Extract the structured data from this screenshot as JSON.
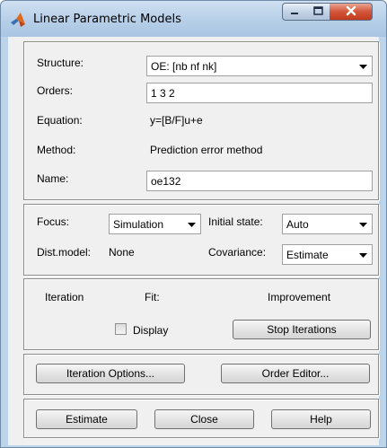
{
  "window": {
    "title": "Linear Parametric Models",
    "icon": "matlab-logo-icon",
    "controls": [
      "minimize-icon",
      "maximize-icon",
      "close-icon"
    ]
  },
  "model": {
    "structure_label": "Structure:",
    "structure_value": "OE: [nb nf nk]",
    "orders_label": "Orders:",
    "orders_value": "1 3 2",
    "equation_label": "Equation:",
    "equation_value": "y=[B/F]u+e",
    "method_label": "Method:",
    "method_value": "Prediction error method",
    "name_label": "Name:",
    "name_value": "oe132"
  },
  "options": {
    "focus_label": "Focus:",
    "focus_value": "Simulation",
    "initial_state_label": "Initial state:",
    "initial_state_value": "Auto",
    "dist_model_label": "Dist.model:",
    "dist_model_value": "None",
    "covariance_label": "Covariance:",
    "covariance_value": "Estimate"
  },
  "iteration": {
    "iteration_header": "Iteration",
    "fit_header": "Fit:",
    "improvement_header": "Improvement",
    "display_label": "Display",
    "display_checked": false,
    "stop_button": "Stop Iterations"
  },
  "tools": {
    "iteration_options_button": "Iteration Options...",
    "order_editor_button": "Order Editor..."
  },
  "actions": {
    "estimate_button": "Estimate",
    "close_button": "Close",
    "help_button": "Help"
  },
  "colors": {
    "frame": "#bcd4ea",
    "close_button": "#c8442a",
    "dialog_background": "#f0f0f0"
  }
}
